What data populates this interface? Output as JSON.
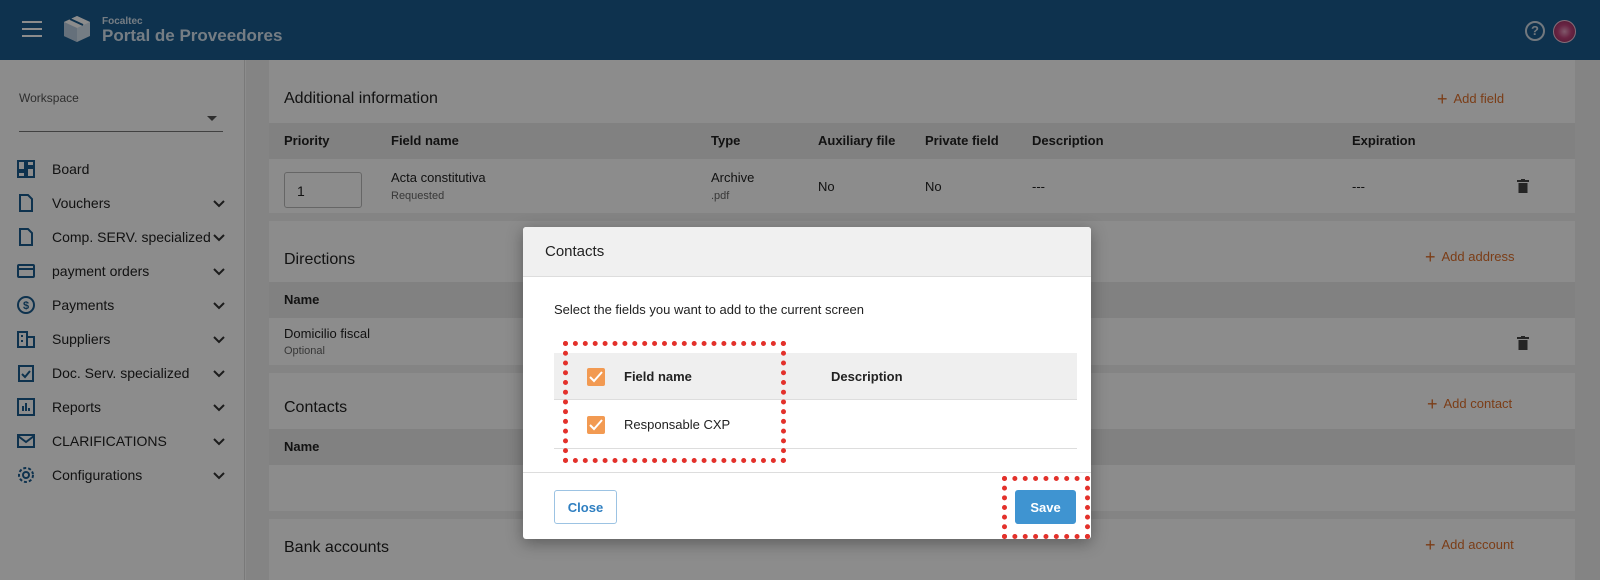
{
  "header": {
    "brand_small": "Focaltec",
    "brand_title": "Portal de Proveedores",
    "help_glyph": "?"
  },
  "sidebar": {
    "workspace_label": "Workspace",
    "workspace_value": "",
    "items": [
      {
        "label": "Board",
        "icon": "dashboard-icon",
        "expandable": false
      },
      {
        "label": "Vouchers",
        "icon": "document-icon",
        "expandable": true
      },
      {
        "label": "Comp. SERV. specialized",
        "icon": "document-icon",
        "expandable": true
      },
      {
        "label": "payment orders",
        "icon": "credit-card-icon",
        "expandable": true
      },
      {
        "label": "Payments",
        "icon": "dollar-circle-icon",
        "expandable": true
      },
      {
        "label": "Suppliers",
        "icon": "building-icon",
        "expandable": true
      },
      {
        "label": "Doc. Serv. specialized",
        "icon": "clipboard-check-icon",
        "expandable": true
      },
      {
        "label": "Reports",
        "icon": "bar-chart-icon",
        "expandable": true
      },
      {
        "label": "CLARIFICATIONS",
        "icon": "mail-icon",
        "expandable": true
      },
      {
        "label": "Configurations",
        "icon": "gear-icon",
        "expandable": true
      }
    ]
  },
  "main": {
    "additional": {
      "title": "Additional information",
      "add_label": "Add field",
      "columns": [
        "Priority",
        "Field name",
        "Type",
        "Auxiliary file",
        "Private field",
        "Description",
        "Expiration"
      ],
      "row": {
        "priority": "1",
        "field_name": "Acta constitutiva",
        "field_status": "Requested",
        "type": "Archive",
        "type_ext": ".pdf",
        "auxiliary": "No",
        "private": "No",
        "description": "---",
        "expiration": "---"
      }
    },
    "directions": {
      "title": "Directions",
      "add_label": "Add address",
      "column": "Name",
      "row_name": "Domicilio fiscal",
      "row_status": "Optional"
    },
    "contacts": {
      "title": "Contacts",
      "add_label": "Add contact",
      "column": "Name"
    },
    "bank": {
      "title": "Bank accounts",
      "add_label": "Add account"
    }
  },
  "modal": {
    "title": "Contacts",
    "instruction": "Select the fields you want to add to the current screen",
    "col_field_name": "Field name",
    "col_description": "Description",
    "row_field_name": "Responsable CXP",
    "row_description": "",
    "close_label": "Close",
    "save_label": "Save",
    "header_checked": true,
    "row_checked": true
  },
  "colors": {
    "topbar": "#1b5c8e",
    "accent_orange": "#e0702a",
    "checkbox": "#f29a52",
    "save_button": "#3f94d1",
    "highlight": "#e3312b"
  }
}
